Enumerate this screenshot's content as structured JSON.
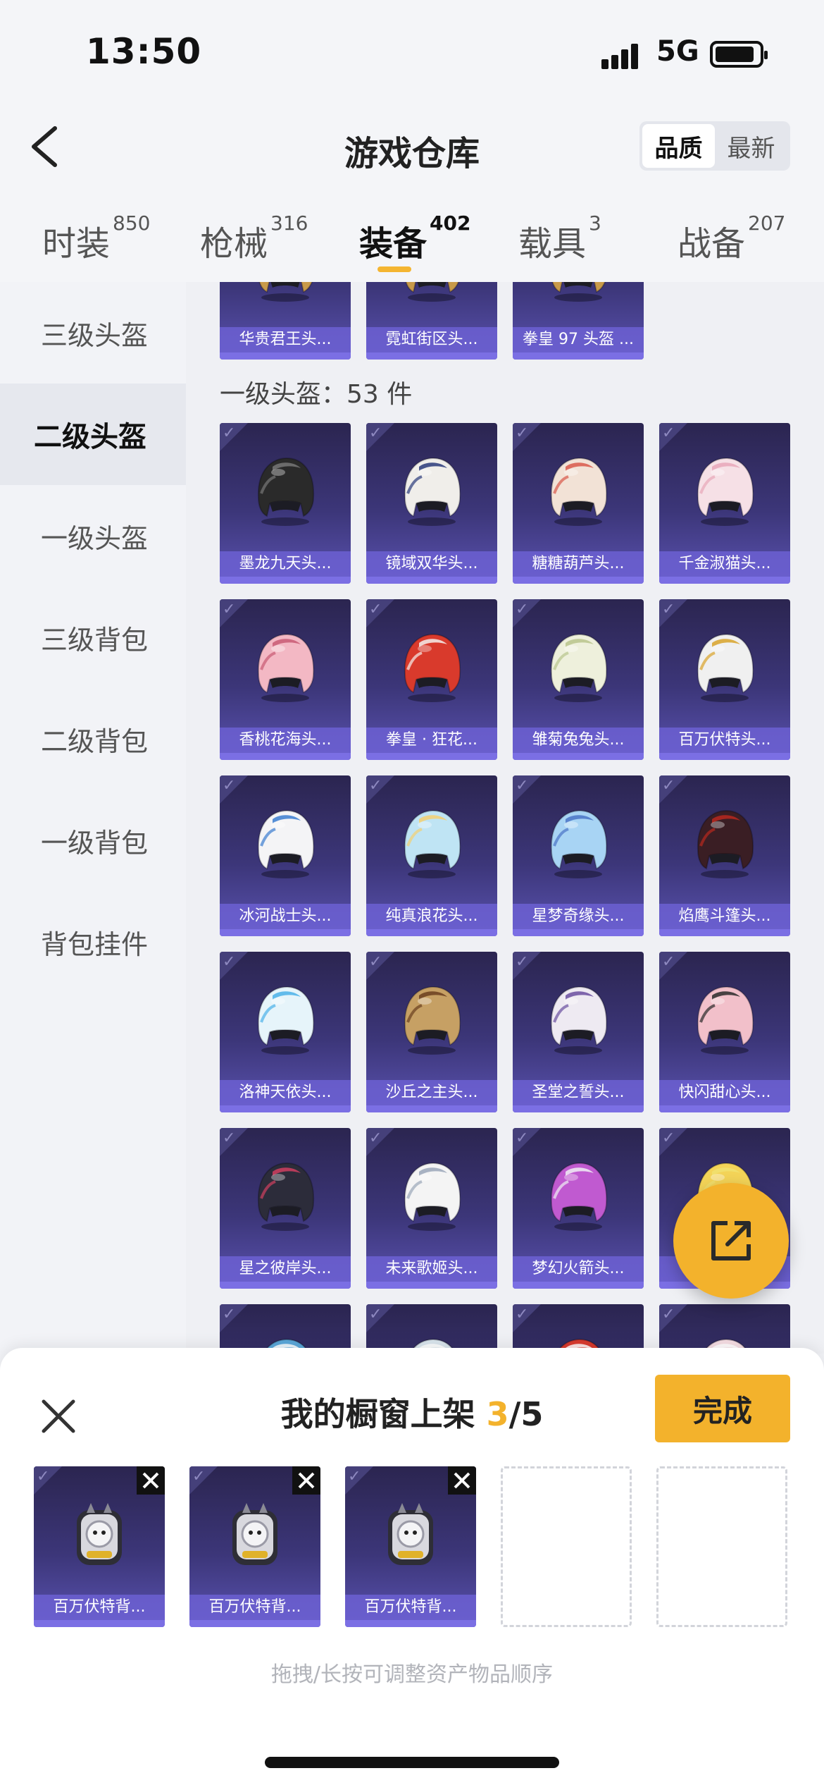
{
  "status_bar": {
    "time": "13:50",
    "network": "5G"
  },
  "nav": {
    "title": "游戏仓库",
    "sort_options": [
      "品质",
      "最新"
    ],
    "sort_active": "品质"
  },
  "tabs": [
    {
      "label": "时装",
      "count": "850"
    },
    {
      "label": "枪械",
      "count": "316"
    },
    {
      "label": "装备",
      "count": "402",
      "active": true
    },
    {
      "label": "载具",
      "count": "3"
    },
    {
      "label": "战备",
      "count": "207"
    }
  ],
  "sidebar": {
    "items": [
      "三级头盔",
      "二级头盔",
      "一级头盔",
      "三级背包",
      "二级背包",
      "一级背包",
      "背包挂件"
    ],
    "active": "二级头盔"
  },
  "prev_section": {
    "items": [
      "华贵君王头...",
      "霓虹街区头...",
      "拳皇 97 头盔 ..."
    ]
  },
  "section": {
    "title": "一级头盔：53 件",
    "items": [
      {
        "name": "墨龙九天头...",
        "color": "#2a2a2a",
        "accent": "#777777"
      },
      {
        "name": "镜域双华头...",
        "color": "#f0eeea",
        "accent": "#2a3a7a"
      },
      {
        "name": "糖糖葫芦头...",
        "color": "#f2e2d6",
        "accent": "#d9584a"
      },
      {
        "name": "千金淑猫头...",
        "color": "#f6e0e6",
        "accent": "#e8a6b8"
      },
      {
        "name": "香桃花海头...",
        "color": "#f3b8c4",
        "accent": "#c85a74"
      },
      {
        "name": "拳皇 · 狂花...",
        "color": "#d93a2c",
        "accent": "#f3f0ec"
      },
      {
        "name": "雏菊兔兔头...",
        "color": "#eef0dc",
        "accent": "#b8c48c"
      },
      {
        "name": "百万伏特头...",
        "color": "#f0f0f0",
        "accent": "#d8a32a"
      },
      {
        "name": "冰河战士头...",
        "color": "#f4f4f6",
        "accent": "#3a7cd0"
      },
      {
        "name": "纯真浪花头...",
        "color": "#bfe4f4",
        "accent": "#f3d070"
      },
      {
        "name": "星梦奇缘头...",
        "color": "#a8d4f4",
        "accent": "#4a74c6"
      },
      {
        "name": "焰鹰斗篷头...",
        "color": "#3a1e24",
        "accent": "#b8281e"
      },
      {
        "name": "洛神天依头...",
        "color": "#e6f4fa",
        "accent": "#4ab0e8"
      },
      {
        "name": "沙丘之主头...",
        "color": "#c6a064",
        "accent": "#6a3e1e"
      },
      {
        "name": "圣堂之誓头...",
        "color": "#eeeaf2",
        "accent": "#6a4ea0"
      },
      {
        "name": "快闪甜心头...",
        "color": "#f2c0ca",
        "accent": "#2a2a2a"
      },
      {
        "name": "星之彼岸头...",
        "color": "#2c2c3a",
        "accent": "#d04060"
      },
      {
        "name": "未来歌姬头...",
        "color": "#f4f4f4",
        "accent": "#9aa6b8"
      },
      {
        "name": "梦幻火箭头...",
        "color": "#c05ad0",
        "accent": "#f0f0f4"
      },
      {
        "name": "夭...",
        "color": "#f4d458",
        "accent": "#f0e070"
      }
    ]
  },
  "sheet": {
    "title": "我的橱窗上架",
    "current": "3",
    "max": "/5",
    "done_label": "完成",
    "slots": [
      {
        "name": "百万伏特背...",
        "filled": true
      },
      {
        "name": "百万伏特背...",
        "filled": true
      },
      {
        "name": "百万伏特背...",
        "filled": true
      },
      {
        "name": "",
        "filled": false
      },
      {
        "name": "",
        "filled": false
      }
    ],
    "hint": "拖拽/长按可调整资产物品顺序"
  },
  "colors": {
    "accent": "#f3b22c",
    "card_bg": "#3c3679",
    "label_bg": "#6c60d2"
  }
}
